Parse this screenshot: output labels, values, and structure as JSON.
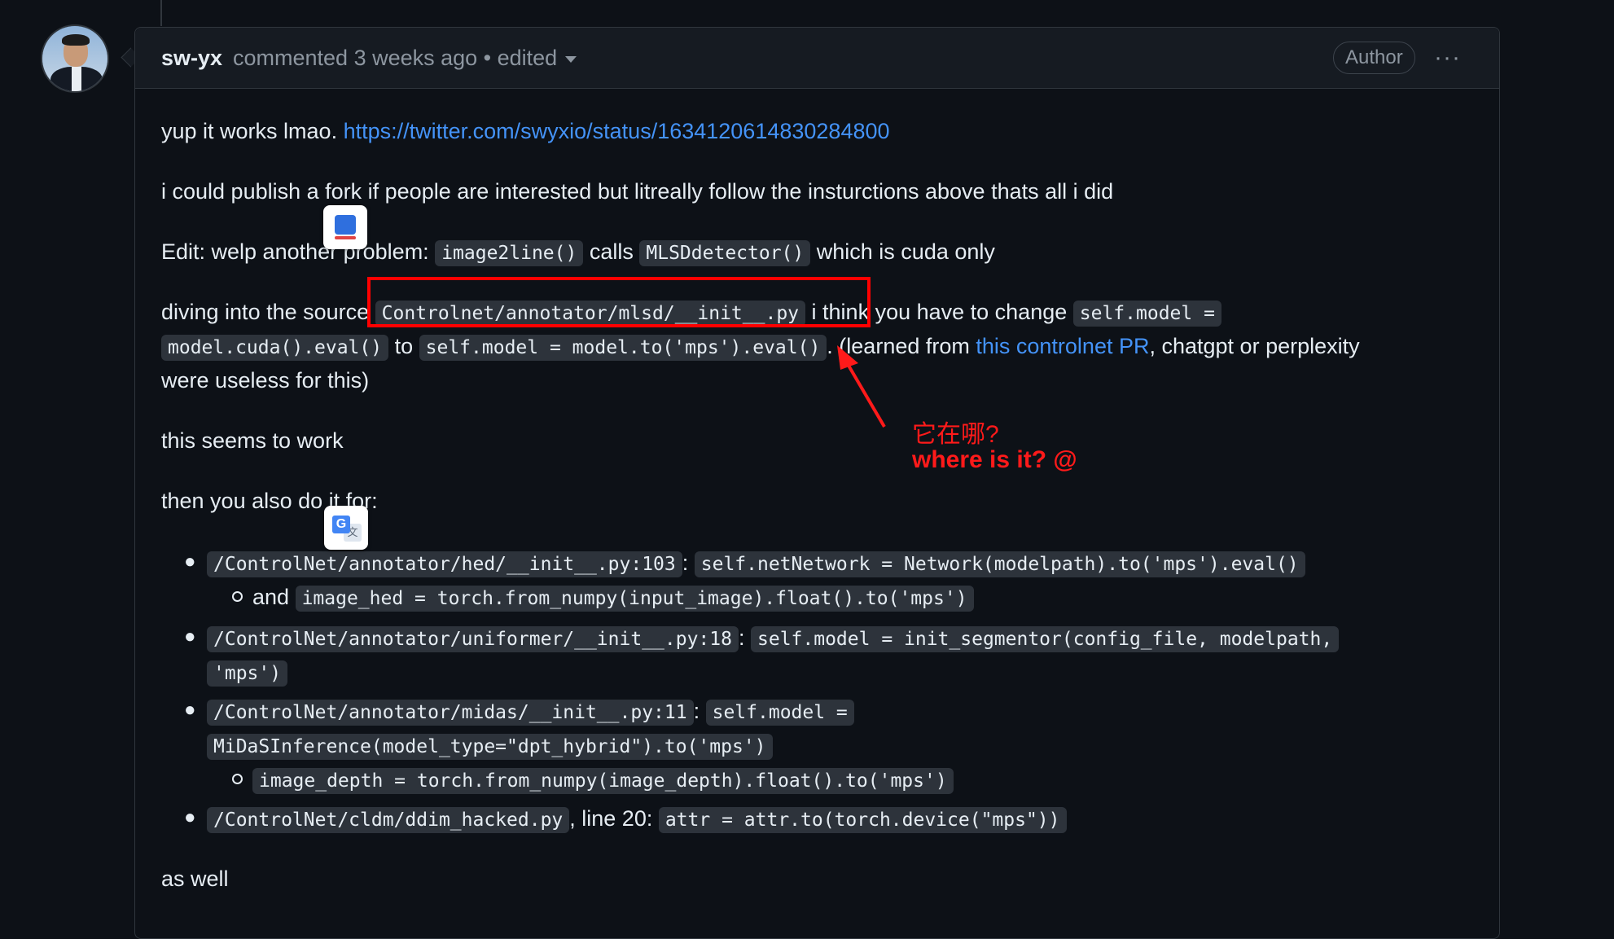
{
  "comment": {
    "author": "sw-yx",
    "meta_text": "commented 3 weeks ago • edited",
    "badge": "Author",
    "menu_label": "···"
  },
  "body": {
    "p1_text": "yup it works lmao. ",
    "p1_link": "https://twitter.com/swyxio/status/1634120614830284800",
    "p2": "i could publish a fork if people are interested but litreally follow the insturctions above thats all i did",
    "p3_a": "Edit: welp another problem: ",
    "p3_code1": "image2line()",
    "p3_b": " calls ",
    "p3_code2": "MLSDdetector()",
    "p3_c": " which is cuda only",
    "p4_a": "diving into the source ",
    "p4_code1": "Controlnet/annotator/mlsd/__init__.py",
    "p4_b": " i think you have to change ",
    "p4_code2a": "self.model =",
    "p4_code2b": "model.cuda().eval()",
    "p4_c": " to ",
    "p4_code3": "self.model = model.to('mps').eval()",
    "p4_d": ". (learned from ",
    "p4_link": "this controlnet PR",
    "p4_e": ", chatgpt or perplexity",
    "p4_f": "were useless for this)",
    "p5": "this seems to work",
    "p6": "then you also do it for:",
    "list": {
      "i1_path": "/ControlNet/annotator/hed/__init__.py:103",
      "i1_sep": ": ",
      "i1_code": "self.netNetwork = Network(modelpath).to('mps').eval()",
      "i1_sub_and": "and ",
      "i1_sub_code": "image_hed = torch.from_numpy(input_image).float().to('mps')",
      "i2_path": "/ControlNet/annotator/uniformer/__init__.py:18",
      "i2_sep": ": ",
      "i2_code_a": "self.model = init_segmentor(config_file, modelpath,",
      "i2_code_b": "'mps')",
      "i3_path": "/ControlNet/annotator/midas/__init__.py:11",
      "i3_sep": ": ",
      "i3_code_a": "self.model =",
      "i3_code_b": "MiDaSInference(model_type=\"dpt_hybrid\").to('mps')",
      "i3_sub_code": "image_depth = torch.from_numpy(image_depth).float().to('mps')",
      "i4_path": "/ControlNet/cldm/ddim_hacked.py",
      "i4_mid": ", line 20: ",
      "i4_code": "attr = attr.to(torch.device(\"mps\"))"
    },
    "p7": "as well"
  },
  "annotation": {
    "line1": "它在哪?",
    "line2": "where is it?  @",
    "color": "#ff1a1a"
  }
}
